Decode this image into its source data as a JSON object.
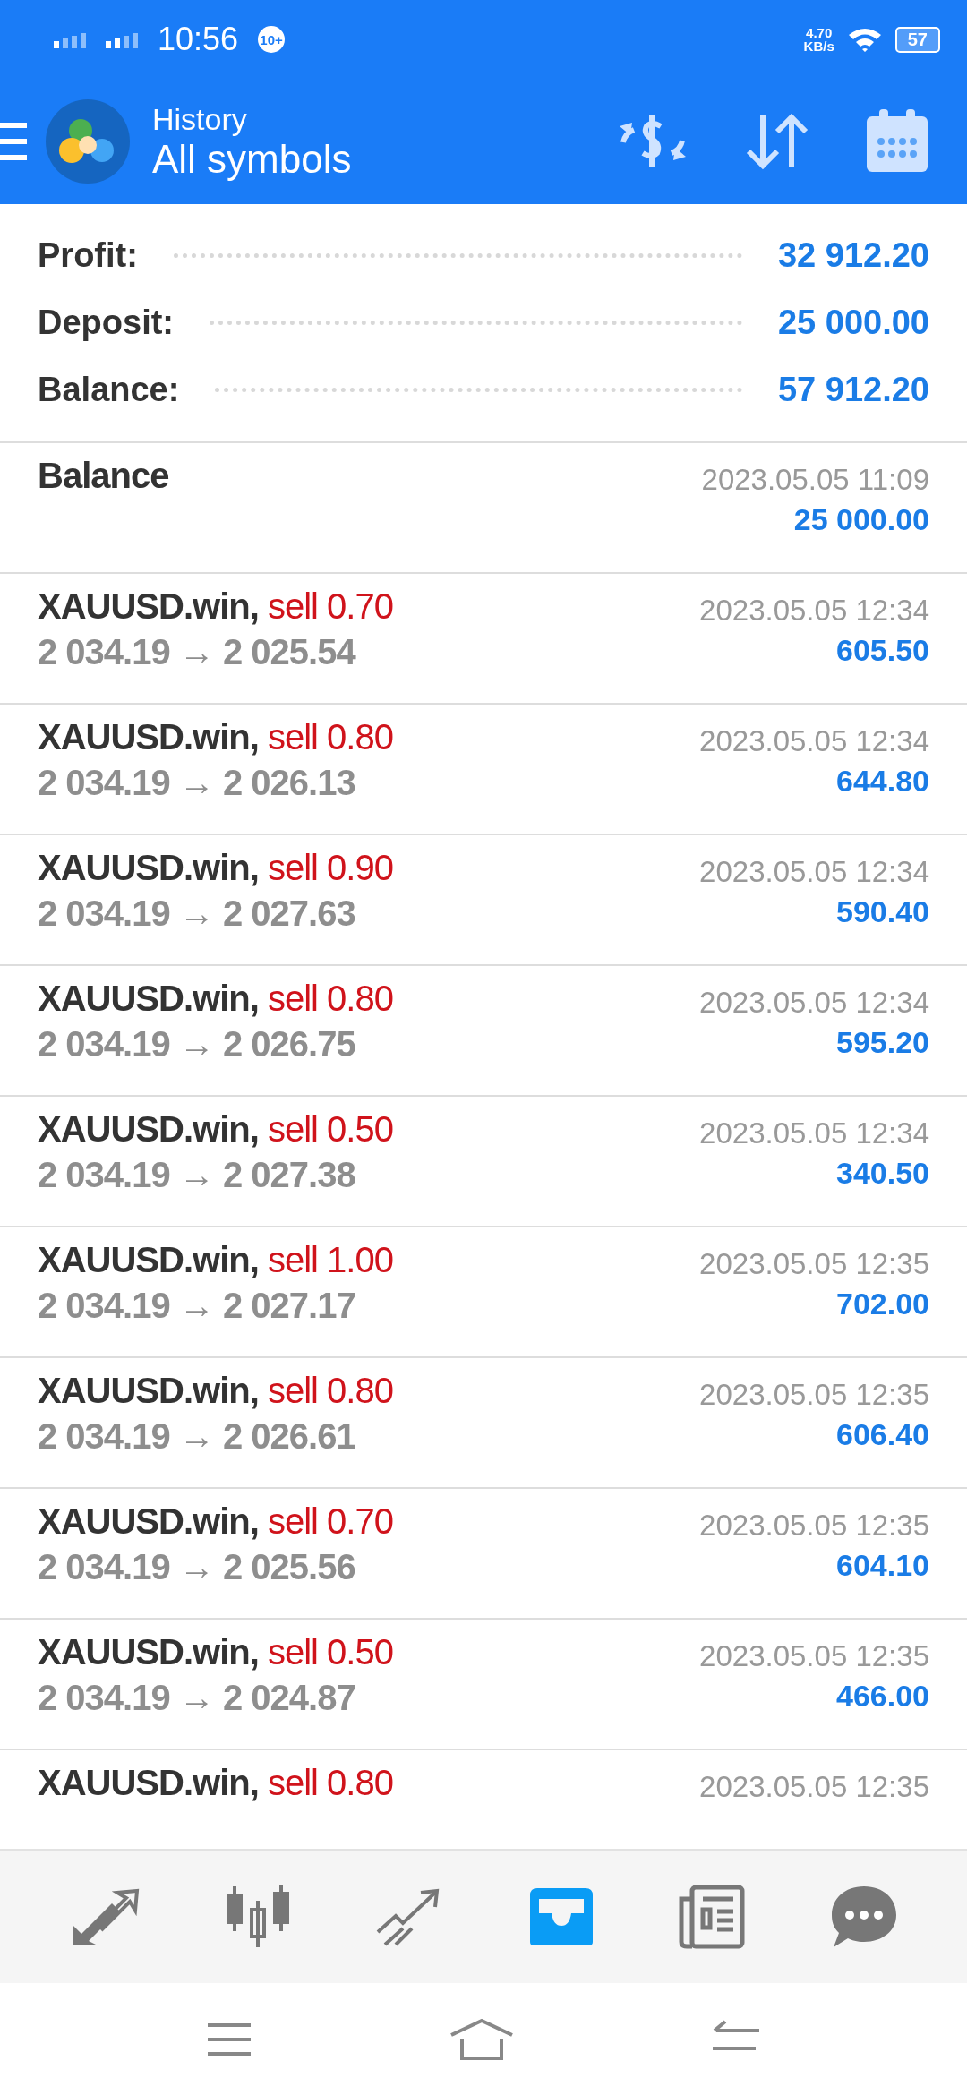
{
  "status_bar": {
    "time": "10:56",
    "badge": "10+",
    "speed": "4.70",
    "speed_unit": "KB/s",
    "battery": "57"
  },
  "header": {
    "title": "History",
    "subtitle": "All symbols"
  },
  "summary": [
    {
      "label": "Profit:",
      "value": "32 912.20"
    },
    {
      "label": "Deposit:",
      "value": "25 000.00"
    },
    {
      "label": "Balance:",
      "value": "57 912.20"
    }
  ],
  "balance_entry": {
    "label": "Balance",
    "time": "2023.05.05 11:09",
    "amount": "25 000.00"
  },
  "deals": [
    {
      "symbol": "XAUUSD.win,",
      "side": "sell 0.70",
      "prices": "2 034.19 → 2 025.54",
      "time": "2023.05.05 12:34",
      "profit": "605.50"
    },
    {
      "symbol": "XAUUSD.win,",
      "side": "sell 0.80",
      "prices": "2 034.19 → 2 026.13",
      "time": "2023.05.05 12:34",
      "profit": "644.80"
    },
    {
      "symbol": "XAUUSD.win,",
      "side": "sell 0.90",
      "prices": "2 034.19 → 2 027.63",
      "time": "2023.05.05 12:34",
      "profit": "590.40"
    },
    {
      "symbol": "XAUUSD.win,",
      "side": "sell 0.80",
      "prices": "2 034.19 → 2 026.75",
      "time": "2023.05.05 12:34",
      "profit": "595.20"
    },
    {
      "symbol": "XAUUSD.win,",
      "side": "sell 0.50",
      "prices": "2 034.19 → 2 027.38",
      "time": "2023.05.05 12:34",
      "profit": "340.50"
    },
    {
      "symbol": "XAUUSD.win,",
      "side": "sell 1.00",
      "prices": "2 034.19 → 2 027.17",
      "time": "2023.05.05 12:35",
      "profit": "702.00"
    },
    {
      "symbol": "XAUUSD.win,",
      "side": "sell 0.80",
      "prices": "2 034.19 → 2 026.61",
      "time": "2023.05.05 12:35",
      "profit": "606.40"
    },
    {
      "symbol": "XAUUSD.win,",
      "side": "sell 0.70",
      "prices": "2 034.19 → 2 025.56",
      "time": "2023.05.05 12:35",
      "profit": "604.10"
    },
    {
      "symbol": "XAUUSD.win,",
      "side": "sell 0.50",
      "prices": "2 034.19 → 2 024.87",
      "time": "2023.05.05 12:35",
      "profit": "466.00"
    },
    {
      "symbol": "XAUUSD.win,",
      "side": "sell 0.80",
      "time": "2023.05.05 12:35"
    }
  ],
  "tabs": [
    {
      "kind": "trade",
      "selected": false
    },
    {
      "kind": "quotes",
      "selected": false
    },
    {
      "kind": "chart",
      "selected": false
    },
    {
      "kind": "history",
      "selected": true
    },
    {
      "kind": "news",
      "selected": false
    },
    {
      "kind": "chat",
      "selected": false
    }
  ]
}
